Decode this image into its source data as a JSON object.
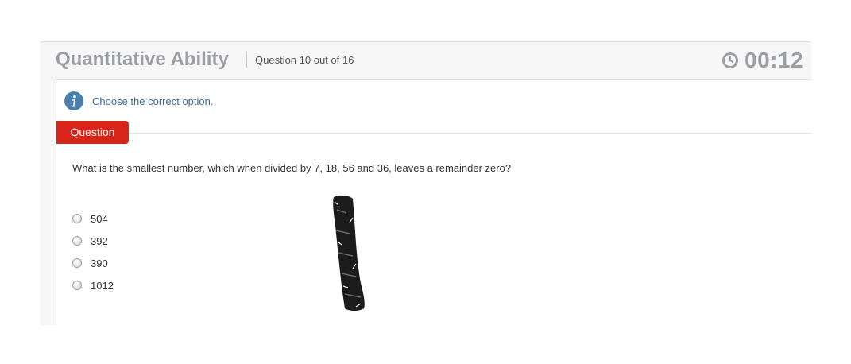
{
  "header": {
    "title": "Quantitative Ability",
    "question_counter": "Question 10 out of 16",
    "timer": "00:12"
  },
  "instruction": {
    "icon": "info-icon",
    "text": "Choose the correct option."
  },
  "question": {
    "tab_label": "Question",
    "text": "What is the smallest number, which when divided by 7, 18, 56 and 36, leaves a remainder zero?",
    "options": [
      {
        "label": "504",
        "selected": false
      },
      {
        "label": "392",
        "selected": false
      },
      {
        "label": "390",
        "selected": false
      },
      {
        "label": "1012",
        "selected": false
      }
    ]
  },
  "colors": {
    "accent_red": "#d9241a",
    "title_gray": "#9b9ea3",
    "info_blue": "#4a7fb0"
  }
}
